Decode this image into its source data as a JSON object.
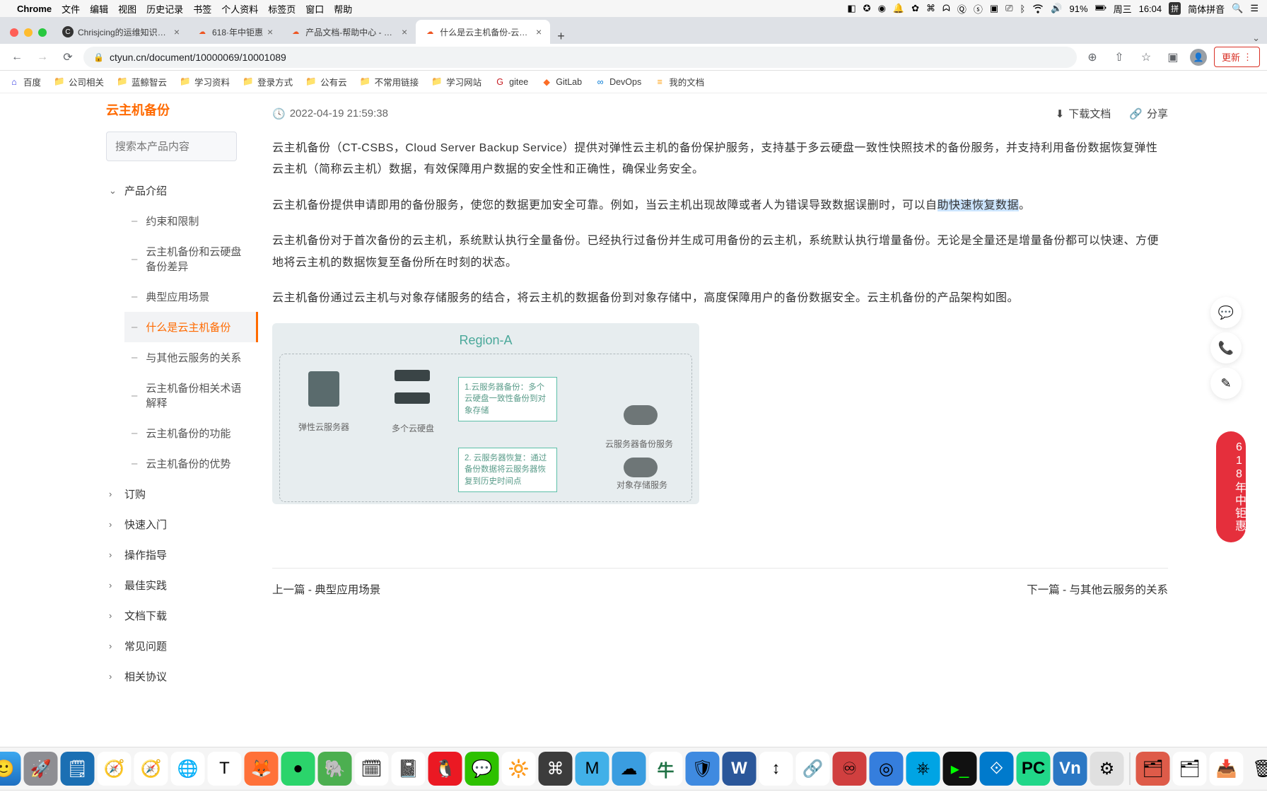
{
  "menubar": {
    "app": "Chrome",
    "items": [
      "文件",
      "编辑",
      "视图",
      "历史记录",
      "书签",
      "个人资料",
      "标签页",
      "窗口",
      "帮助"
    ],
    "battery": "91%",
    "day": "周三",
    "time": "16:04",
    "ime": "简体拼音"
  },
  "tabs": [
    {
      "title": "Chrisjcing的运维知识体系"
    },
    {
      "title": "618·年中钜惠"
    },
    {
      "title": "产品文档-帮助中心 - 天翼云"
    },
    {
      "title": "什么是云主机备份-云主机备份-/"
    }
  ],
  "url": "ctyun.cn/document/10000069/10001089",
  "update_label": "更新",
  "bookmarks": [
    "百度",
    "公司相关",
    "蓝鲸智云",
    "学习资料",
    "登录方式",
    "公有云",
    "不常用链接",
    "学习网站",
    "gitee",
    "GitLab",
    "DevOps",
    "我的文档"
  ],
  "sidebar": {
    "title": "云主机备份",
    "search_placeholder": "搜索本产品内容",
    "sections": [
      {
        "label": "产品介绍",
        "expanded": true,
        "subs": [
          {
            "label": "约束和限制"
          },
          {
            "label": "云主机备份和云硬盘备份差异"
          },
          {
            "label": "典型应用场景"
          },
          {
            "label": "什么是云主机备份",
            "active": true
          },
          {
            "label": "与其他云服务的关系"
          },
          {
            "label": "云主机备份相关术语解释"
          },
          {
            "label": "云主机备份的功能"
          },
          {
            "label": "云主机备份的优势"
          }
        ]
      },
      {
        "label": "订购"
      },
      {
        "label": "快速入门"
      },
      {
        "label": "操作指导"
      },
      {
        "label": "最佳实践"
      },
      {
        "label": "文档下载"
      },
      {
        "label": "常见问题"
      },
      {
        "label": "相关协议"
      }
    ]
  },
  "article": {
    "timestamp": "2022-04-19 21:59:38",
    "download": "下载文档",
    "share": "分享",
    "p1": "云主机备份（CT-CSBS，Cloud Server Backup Service）提供对弹性云主机的备份保护服务，支持基于多云硬盘一致性快照技术的备份服务，并支持利用备份数据恢复弹性云主机（简称云主机）数据，有效保障用户数据的安全性和正确性，确保业务安全。",
    "p2_a": "云主机备份提供申请即用的备份服务，使您的数据更加安全可靠。例如，当云主机出现故障或者人为错误导致数据误删时，可以自",
    "p2_hl": "助快速恢复数据",
    "p2_b": "。",
    "p3": "云主机备份对于首次备份的云主机，系统默认执行全量备份。已经执行过备份并生成可用备份的云主机，系统默认执行增量备份。无论是全量还是增量备份都可以快速、方便地将云主机的数据恢复至备份所在时刻的状态。",
    "p4": "云主机备份通过云主机与对象存储服务的结合，将云主机的数据备份到对象存储中，高度保障用户的备份数据安全。云主机备份的产品架构如图。"
  },
  "diagram": {
    "region": "Region-A",
    "server_label": "弹性云服务器",
    "disks_label": "多个云硬盘",
    "backup_svc": "云服务器备份服务",
    "obs_svc": "对象存储服务",
    "box1": "1.云服务器备份：多个云硬盘一致性备份到对象存储",
    "box2": "2. 云服务器恢复：通过备份数据将云服务器恢复到历史时间点"
  },
  "pager": {
    "prev_label": "上一篇 -",
    "prev": "典型应用场景",
    "next_label": "下一篇 -",
    "next": "与其他云服务的关系"
  },
  "promo": "618年中钜惠"
}
